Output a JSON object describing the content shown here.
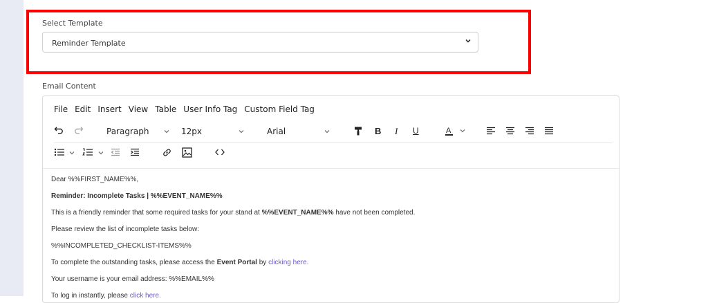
{
  "select_template": {
    "label": "Select Template",
    "selected": "Reminder Template"
  },
  "email_content": {
    "label": "Email Content",
    "menu": [
      "File",
      "Edit",
      "Insert",
      "View",
      "Table",
      "User Info Tag",
      "Custom Field Tag"
    ],
    "toolbar": {
      "block_format": "Paragraph",
      "font_size": "12px",
      "font_family": "Arial"
    },
    "body": {
      "greeting": "Dear %%FIRST_NAME%%,",
      "heading": "Reminder: Incomplete Tasks | %%EVENT_NAME%%",
      "p1_before": "This is a friendly reminder that some required tasks for your stand at ",
      "p1_bold": "%%EVENT_NAME%%",
      "p1_after": " have not been completed.",
      "p2": "Please review the list of incomplete tasks below:",
      "p3": "%%INCOMPLETED_CHECKLIST-ITEMS%%",
      "p4_before": "To complete the outstanding tasks, please access the ",
      "p4_bold": "Event Portal",
      "p4_mid": " by ",
      "p4_link": "clicking here.",
      "p5": "Your username is your email address: %%EMAIL%%",
      "p6_before": "To log in instantly, please ",
      "p6_link": "click here."
    }
  },
  "colors": {
    "highlight": "#ff0000",
    "link": "#6b5ac8",
    "sidebar": "#e9ebf4"
  }
}
